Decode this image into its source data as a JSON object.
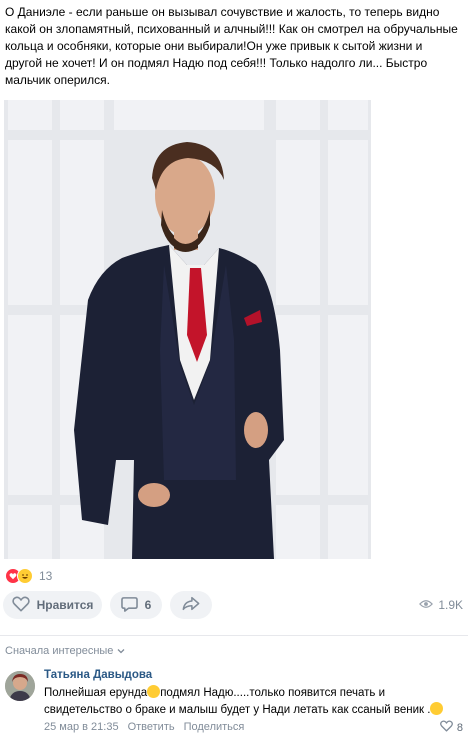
{
  "post": {
    "text": "О Даниэле - если раньше он вызывал сочувствие и жалость, то теперь видно какой он злопамятный, психованный и алчный!!! Как он смотрел на обручальные кольца и особняки, которые они выбирали!Он уже привык к сытой жизни и другой не хочет! И он подмял Надю под себя!!! Только надолго ли... Быстро мальчик оперился."
  },
  "reactions": {
    "count": "13"
  },
  "actions": {
    "like_label": "Нравится",
    "comment_count": "6",
    "views": "1.9K"
  },
  "comments_sort": "Сначала интересные",
  "comment": {
    "author": "Татьяна Давыдова",
    "text_part1": "Полнейшая ерунда",
    "text_part2": "подмял Надю.....только появится печать и свидетельство о браке и малыш будет у Нади летать как ссаный веник .",
    "date": "25 мар в 21:35",
    "reply": "Ответить",
    "share": "Поделиться",
    "likes": "8"
  },
  "colors": {
    "accent": "#2a5885",
    "muted": "#818c99",
    "pill_bg": "#f0f2f5",
    "heart": "#ff3347"
  }
}
